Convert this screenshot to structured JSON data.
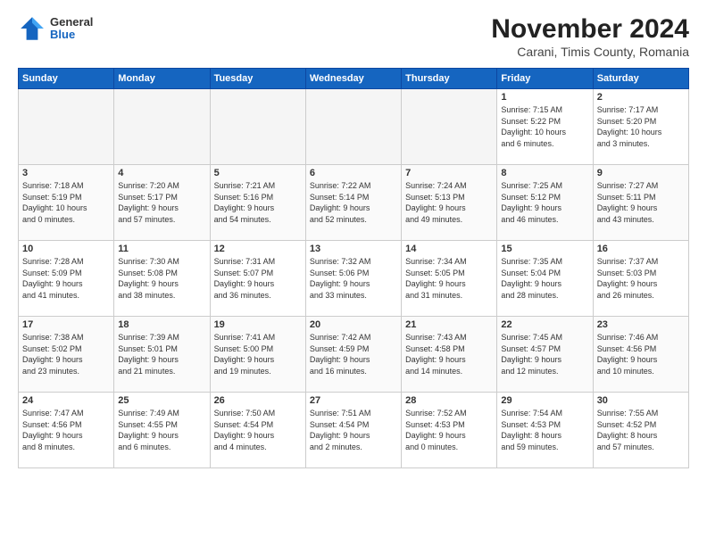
{
  "header": {
    "logo_general": "General",
    "logo_blue": "Blue",
    "month_title": "November 2024",
    "subtitle": "Carani, Timis County, Romania"
  },
  "calendar": {
    "headers": [
      "Sunday",
      "Monday",
      "Tuesday",
      "Wednesday",
      "Thursday",
      "Friday",
      "Saturday"
    ],
    "weeks": [
      [
        {
          "day": "",
          "info": ""
        },
        {
          "day": "",
          "info": ""
        },
        {
          "day": "",
          "info": ""
        },
        {
          "day": "",
          "info": ""
        },
        {
          "day": "",
          "info": ""
        },
        {
          "day": "1",
          "info": "Sunrise: 7:15 AM\nSunset: 5:22 PM\nDaylight: 10 hours\nand 6 minutes."
        },
        {
          "day": "2",
          "info": "Sunrise: 7:17 AM\nSunset: 5:20 PM\nDaylight: 10 hours\nand 3 minutes."
        }
      ],
      [
        {
          "day": "3",
          "info": "Sunrise: 7:18 AM\nSunset: 5:19 PM\nDaylight: 10 hours\nand 0 minutes."
        },
        {
          "day": "4",
          "info": "Sunrise: 7:20 AM\nSunset: 5:17 PM\nDaylight: 9 hours\nand 57 minutes."
        },
        {
          "day": "5",
          "info": "Sunrise: 7:21 AM\nSunset: 5:16 PM\nDaylight: 9 hours\nand 54 minutes."
        },
        {
          "day": "6",
          "info": "Sunrise: 7:22 AM\nSunset: 5:14 PM\nDaylight: 9 hours\nand 52 minutes."
        },
        {
          "day": "7",
          "info": "Sunrise: 7:24 AM\nSunset: 5:13 PM\nDaylight: 9 hours\nand 49 minutes."
        },
        {
          "day": "8",
          "info": "Sunrise: 7:25 AM\nSunset: 5:12 PM\nDaylight: 9 hours\nand 46 minutes."
        },
        {
          "day": "9",
          "info": "Sunrise: 7:27 AM\nSunset: 5:11 PM\nDaylight: 9 hours\nand 43 minutes."
        }
      ],
      [
        {
          "day": "10",
          "info": "Sunrise: 7:28 AM\nSunset: 5:09 PM\nDaylight: 9 hours\nand 41 minutes."
        },
        {
          "day": "11",
          "info": "Sunrise: 7:30 AM\nSunset: 5:08 PM\nDaylight: 9 hours\nand 38 minutes."
        },
        {
          "day": "12",
          "info": "Sunrise: 7:31 AM\nSunset: 5:07 PM\nDaylight: 9 hours\nand 36 minutes."
        },
        {
          "day": "13",
          "info": "Sunrise: 7:32 AM\nSunset: 5:06 PM\nDaylight: 9 hours\nand 33 minutes."
        },
        {
          "day": "14",
          "info": "Sunrise: 7:34 AM\nSunset: 5:05 PM\nDaylight: 9 hours\nand 31 minutes."
        },
        {
          "day": "15",
          "info": "Sunrise: 7:35 AM\nSunset: 5:04 PM\nDaylight: 9 hours\nand 28 minutes."
        },
        {
          "day": "16",
          "info": "Sunrise: 7:37 AM\nSunset: 5:03 PM\nDaylight: 9 hours\nand 26 minutes."
        }
      ],
      [
        {
          "day": "17",
          "info": "Sunrise: 7:38 AM\nSunset: 5:02 PM\nDaylight: 9 hours\nand 23 minutes."
        },
        {
          "day": "18",
          "info": "Sunrise: 7:39 AM\nSunset: 5:01 PM\nDaylight: 9 hours\nand 21 minutes."
        },
        {
          "day": "19",
          "info": "Sunrise: 7:41 AM\nSunset: 5:00 PM\nDaylight: 9 hours\nand 19 minutes."
        },
        {
          "day": "20",
          "info": "Sunrise: 7:42 AM\nSunset: 4:59 PM\nDaylight: 9 hours\nand 16 minutes."
        },
        {
          "day": "21",
          "info": "Sunrise: 7:43 AM\nSunset: 4:58 PM\nDaylight: 9 hours\nand 14 minutes."
        },
        {
          "day": "22",
          "info": "Sunrise: 7:45 AM\nSunset: 4:57 PM\nDaylight: 9 hours\nand 12 minutes."
        },
        {
          "day": "23",
          "info": "Sunrise: 7:46 AM\nSunset: 4:56 PM\nDaylight: 9 hours\nand 10 minutes."
        }
      ],
      [
        {
          "day": "24",
          "info": "Sunrise: 7:47 AM\nSunset: 4:56 PM\nDaylight: 9 hours\nand 8 minutes."
        },
        {
          "day": "25",
          "info": "Sunrise: 7:49 AM\nSunset: 4:55 PM\nDaylight: 9 hours\nand 6 minutes."
        },
        {
          "day": "26",
          "info": "Sunrise: 7:50 AM\nSunset: 4:54 PM\nDaylight: 9 hours\nand 4 minutes."
        },
        {
          "day": "27",
          "info": "Sunrise: 7:51 AM\nSunset: 4:54 PM\nDaylight: 9 hours\nand 2 minutes."
        },
        {
          "day": "28",
          "info": "Sunrise: 7:52 AM\nSunset: 4:53 PM\nDaylight: 9 hours\nand 0 minutes."
        },
        {
          "day": "29",
          "info": "Sunrise: 7:54 AM\nSunset: 4:53 PM\nDaylight: 8 hours\nand 59 minutes."
        },
        {
          "day": "30",
          "info": "Sunrise: 7:55 AM\nSunset: 4:52 PM\nDaylight: 8 hours\nand 57 minutes."
        }
      ]
    ]
  }
}
